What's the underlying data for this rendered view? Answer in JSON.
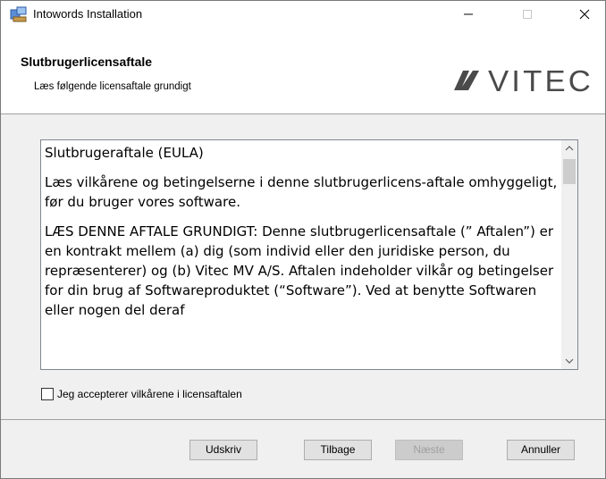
{
  "window": {
    "title": "Intowords Installation",
    "controls": {
      "minimize": "—",
      "maximize": "☐",
      "close": "✕"
    }
  },
  "header": {
    "title": "Slutbrugerlicensaftale",
    "subtitle": "Læs følgende licensaftale grundigt",
    "logo_text": "VITEC"
  },
  "license": {
    "paragraphs": [
      "Slutbrugeraftale (EULA)",
      "Læs vilkårene og betingelserne i denne slutbrugerlicens-aftale omhyggeligt, før du bruger vores software.",
      "LÆS DENNE AFTALE GRUNDIGT: Denne slutbrugerlicensaftale (” Aftalen”) er en kontrakt mellem (a) dig (som individ eller den juridiske person, du repræsenterer) og (b) Vitec MV A/S. Aftalen indeholder vilkår og betingelser for din brug af Softwareproduktet (“Software”). Ved at benytte Softwaren eller nogen del deraf"
    ]
  },
  "accept": {
    "label": "Jeg accepterer vilkårene i licensaftalen",
    "checked": false
  },
  "buttons": {
    "print": "Udskriv",
    "back": "Tilbage",
    "next": "Næste",
    "cancel": "Annuller"
  },
  "colors": {
    "logo": "#4a4a4a",
    "disabled_text": "#a0a0a0"
  }
}
